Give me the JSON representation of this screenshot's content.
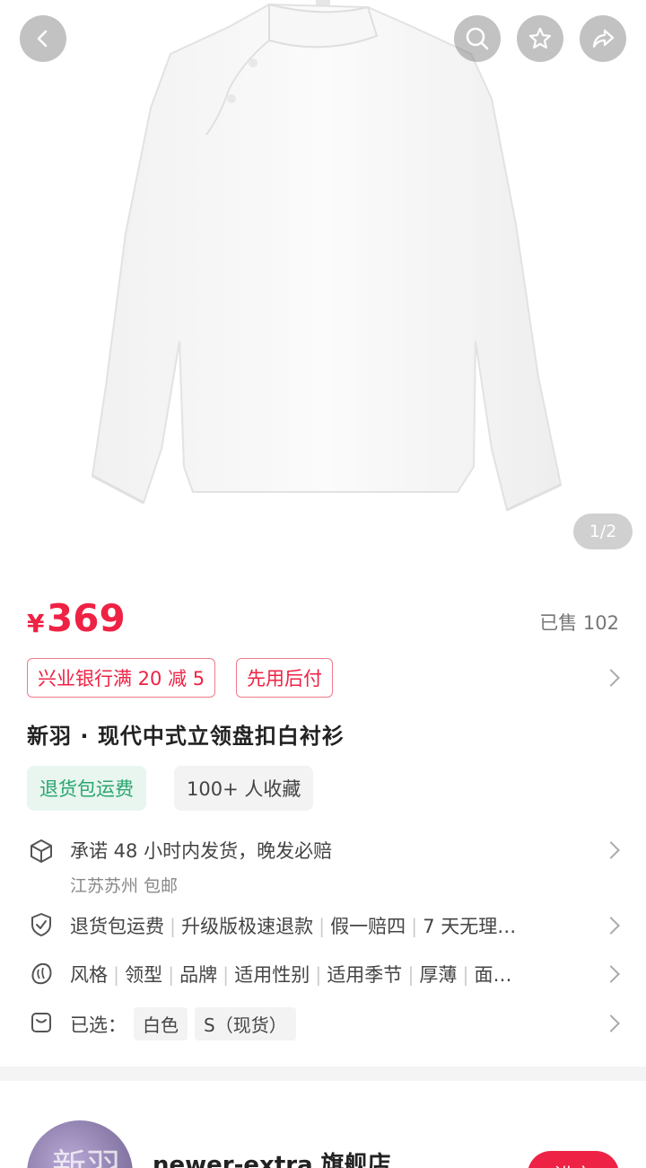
{
  "hero": {
    "page_indicator": "1/2",
    "buttons": {
      "back": "back-icon",
      "search": "search-icon",
      "favorite": "star-icon",
      "share": "share-icon"
    }
  },
  "product": {
    "currency_symbol": "¥",
    "price": "369",
    "sold": "已售 102",
    "promos": [
      "兴业银行满 20 减 5",
      "先用后付"
    ],
    "title": "新羽 · 现代中式立领盘扣白衬衫",
    "badges": [
      "退货包运费",
      "100+ 人收藏"
    ]
  },
  "details": {
    "shipping": {
      "text": "承诺 48 小时内发货，晚发必赔",
      "sub": "江苏苏州 包邮"
    },
    "guarantee": [
      "退货包运费",
      "升级版极速退款",
      "假一赔四",
      "7 天无理…"
    ],
    "params": [
      "风格",
      "领型",
      "品牌",
      "适用性别",
      "适用季节",
      "厚薄",
      "面…"
    ],
    "selected": {
      "label": "已选：",
      "options": [
        "白色",
        "S（现货）"
      ]
    }
  },
  "shop": {
    "avatar_text": "新羽",
    "name": "newer-extra 旗舰店",
    "enter_label": "进店"
  },
  "colors": {
    "accent": "#ee2244",
    "green": "#2aa56e"
  }
}
